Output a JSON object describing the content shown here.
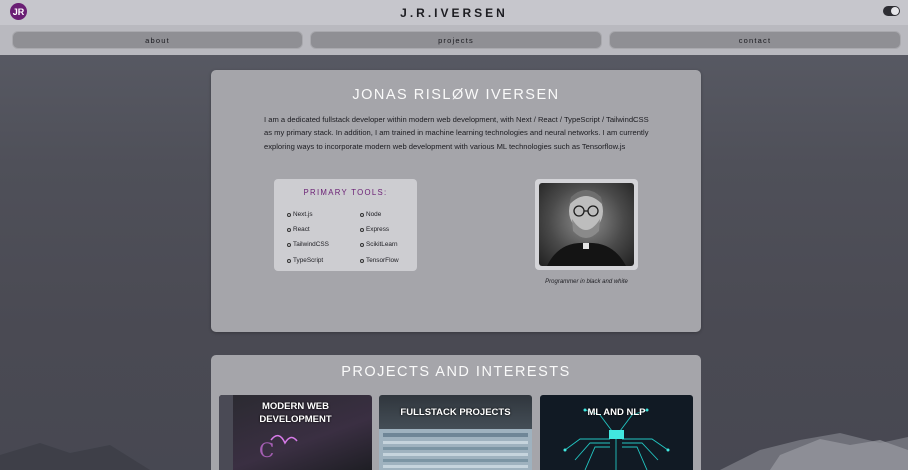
{
  "header": {
    "logo_text": "JR",
    "site_title": "J.R.IVERSEN",
    "theme_toggle": "dark-mode-toggle"
  },
  "nav": {
    "items": [
      {
        "label": "about"
      },
      {
        "label": "projects"
      },
      {
        "label": "contact"
      }
    ]
  },
  "about": {
    "title": "JONAS RISLØW IVERSEN",
    "bio": "I am a dedicated fullstack developer within modern web development, with Next / React / TypeScript / TailwindCSS as my primary stack. In addition, I am trained in machine learning technologies and neural networks. I am currently exploring ways to incorporate modern web development with various ML technologies such as Tensorflow.js",
    "tools_title": "PRIMARY TOOLS:",
    "tools": [
      "Next.js",
      "React",
      "TailwindCSS",
      "TypeScript",
      "Node",
      "Express",
      "ScikitLearn",
      "TensorFlow"
    ],
    "portrait_caption": "Programmer in black and white"
  },
  "projects": {
    "title": "PROJECTS AND INTERESTS",
    "cards": [
      {
        "label_line1": "MODERN WEB",
        "label_line2": "DEVELOPMENT"
      },
      {
        "label_line1": "FULLSTACK PROJECTS",
        "label_line2": ""
      },
      {
        "label_line1": "ML AND NLP",
        "label_line2": ""
      }
    ]
  },
  "colors": {
    "accent": "#6a1e74",
    "card_bg": "#a5a5aa",
    "nav_bg": "#b9b9bf"
  }
}
